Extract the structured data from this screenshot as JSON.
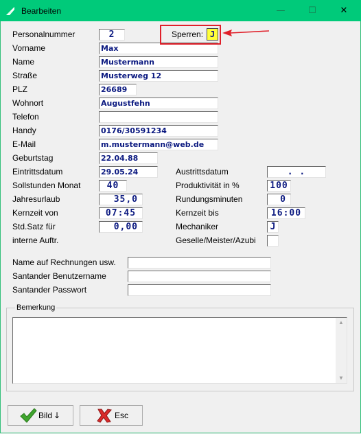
{
  "window": {
    "title": "Bearbeiten",
    "minimize": "—",
    "maximize": "☐",
    "close": "✕"
  },
  "labels": {
    "personalnummer": "Personalnummer",
    "vorname": "Vorname",
    "name": "Name",
    "strasse": "Straße",
    "plz": "PLZ",
    "wohnort": "Wohnort",
    "telefon": "Telefon",
    "handy": "Handy",
    "email": "E-Mail",
    "geburtstag": "Geburtstag",
    "eintrittsdatum": "Eintrittsdatum",
    "sollstunden": "Sollstunden Monat",
    "jahresurlaub": "Jahresurlaub",
    "kernzeit_von": "Kernzeit von",
    "std_satz_1": "Std.Satz für",
    "std_satz_2": "interne Auftr.",
    "sperren": "Sperren:",
    "austrittsdatum": "Austrittsdatum",
    "produktivitaet": "Produktivität in %",
    "rundungsminuten": "Rundungsminuten",
    "kernzeit_bis": "Kernzeit bis",
    "mechaniker": "Mechaniker",
    "geselle": "Geselle/Meister/Azubi",
    "name_rechnungen": "Name auf Rechnungen usw.",
    "santander_user": "Santander Benutzername",
    "santander_pw": "Santander Passwort",
    "bemerkung": "Bemerkung"
  },
  "values": {
    "personalnummer": "2",
    "vorname": "Max",
    "name": "Mustermann",
    "strasse": "Musterweg 12",
    "plz": "26689",
    "wohnort": "Augustfehn",
    "telefon": "",
    "handy": "0176/30591234",
    "email": "m.mustermann@web.de",
    "geburtstag": "22.04.88",
    "eintrittsdatum": "29.05.24",
    "sollstunden": "40",
    "jahresurlaub": "35,0",
    "kernzeit_von": "07:45",
    "std_satz": "0,00",
    "sperren": "J",
    "austrittsdatum": ". .",
    "produktivitaet": "100",
    "rundungsminuten": "0",
    "kernzeit_bis": "16:00",
    "mechaniker": "J",
    "geselle": "",
    "name_rechnungen": "",
    "santander_user": "",
    "santander_pw": "",
    "bemerkung": ""
  },
  "buttons": {
    "bild": "Bild",
    "bild_arrow": "↓",
    "esc": "Esc"
  },
  "colors": {
    "titlebar": "#00ca7a",
    "highlight_border": "#e0202a",
    "field_text": "#0b1980",
    "sperren_bg": "#ffff3a"
  }
}
